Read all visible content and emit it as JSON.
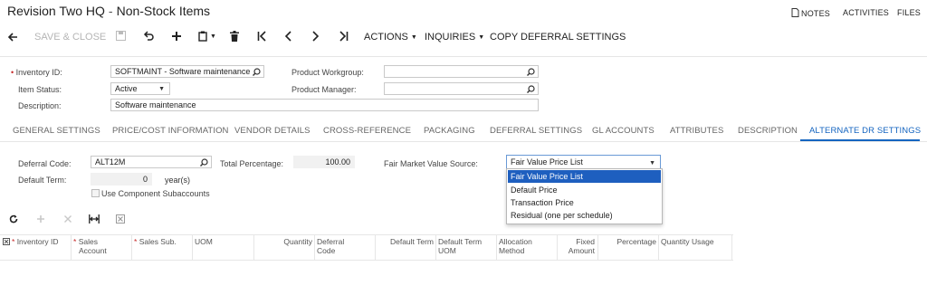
{
  "title": {
    "company": "Revision Two HQ",
    "separator": "-",
    "screen": "Non-Stock Items"
  },
  "topbar": {
    "notes": "NOTES",
    "activities": "ACTIVITIES",
    "files": "FILES"
  },
  "toolbar": {
    "save_close": "SAVE & CLOSE",
    "actions": "ACTIONS",
    "inquiries": "INQUIRIES",
    "copy_deferral": "COPY DEFERRAL SETTINGS"
  },
  "form": {
    "inventory_id_label": "Inventory ID:",
    "inventory_id_value": "SOFTMAINT - Software maintenance",
    "item_status_label": "Item Status:",
    "item_status_value": "Active",
    "description_label": "Description:",
    "description_value": "Software maintenance",
    "product_workgroup_label": "Product Workgroup:",
    "product_workgroup_value": "",
    "product_manager_label": "Product Manager:",
    "product_manager_value": ""
  },
  "tabs": [
    "GENERAL SETTINGS",
    "PRICE/COST INFORMATION",
    "VENDOR DETAILS",
    "CROSS-REFERENCE",
    "PACKAGING",
    "DEFERRAL SETTINGS",
    "GL ACCOUNTS",
    "ATTRIBUTES",
    "DESCRIPTION",
    "ALTERNATE DR SETTINGS"
  ],
  "active_tab_index": 9,
  "deferral": {
    "code_label": "Deferral Code:",
    "code_value": "ALT12M",
    "term_label": "Default Term:",
    "term_value": "0",
    "term_unit": "year(s)",
    "use_component_label": "Use Component Subaccounts",
    "total_pct_label": "Total Percentage:",
    "total_pct_value": "100.00",
    "fmv_label": "Fair Market Value Source:",
    "fmv_value": "Fair Value Price List"
  },
  "dropdown_options": [
    "Fair Value Price List",
    "Default Price",
    "Transaction Price",
    "Residual (one per schedule)"
  ],
  "grid": {
    "columns": [
      {
        "line1": "Inventory ID",
        "line2": "",
        "required": true
      },
      {
        "line1": "Sales",
        "line2": "Account",
        "required": true
      },
      {
        "line1": "Sales Sub.",
        "line2": "",
        "required": true
      },
      {
        "line1": "UOM",
        "line2": "",
        "required": false
      },
      {
        "line1": "Quantity",
        "line2": "",
        "required": false
      },
      {
        "line1": "Deferral",
        "line2": "Code",
        "required": false
      },
      {
        "line1": "Default Term",
        "line2": "",
        "required": false
      },
      {
        "line1": "Default Term",
        "line2": "UOM",
        "required": false
      },
      {
        "line1": "Allocation",
        "line2": "Method",
        "required": false
      },
      {
        "line1": "Fixed",
        "line2": "Amount",
        "required": false
      },
      {
        "line1": "Percentage",
        "line2": "",
        "required": false
      },
      {
        "line1": "Quantity Usage",
        "line2": "",
        "required": false
      }
    ]
  },
  "colors": {
    "accent": "#1565c0",
    "required": "#c62828",
    "highlight": "#1e5fbf"
  }
}
